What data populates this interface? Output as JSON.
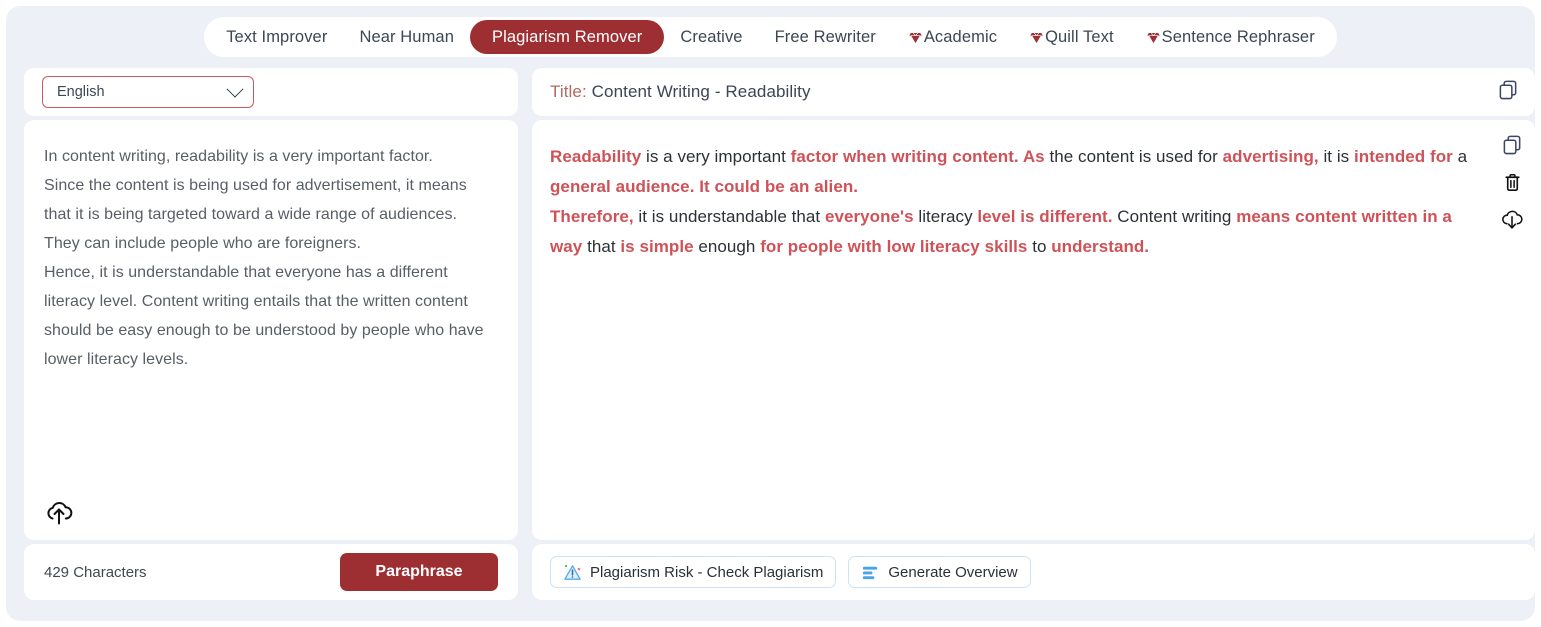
{
  "tabs": [
    {
      "label": "Text Improver",
      "active": false,
      "gem": false
    },
    {
      "label": "Near Human",
      "active": false,
      "gem": false
    },
    {
      "label": "Plagiarism Remover",
      "active": true,
      "gem": false
    },
    {
      "label": "Creative",
      "active": false,
      "gem": false
    },
    {
      "label": "Free Rewriter",
      "active": false,
      "gem": false
    },
    {
      "label": "Academic",
      "active": false,
      "gem": true
    },
    {
      "label": "Quill Text",
      "active": false,
      "gem": true
    },
    {
      "label": "Sentence Rephraser",
      "active": false,
      "gem": true
    }
  ],
  "left_panel": {
    "language_selected": "English",
    "language_icon": "chevron-down-icon",
    "input_text": "In content writing, readability is a very important factor.\nSince the content is being used for advertisement, it means that it is being targeted toward a wide range of audiences.\nThey can include people who are foreigners.\nHence, it is understandable that everyone has a different literacy level. Content writing entails that the written content should be easy enough to be understood by people who have lower literacy levels.",
    "upload_icon": "upload-cloud-icon",
    "character_count": "429 Characters",
    "paraphrase_label": "Paraphrase"
  },
  "right_panel": {
    "title_label": "Title:",
    "title_value": "Content Writing - Readability",
    "header_copy_icon": "copy-icon",
    "side_icons": [
      "copy-icon",
      "trash-icon",
      "download-cloud-icon"
    ],
    "output_segments": [
      {
        "text": "Readability",
        "highlight": true
      },
      {
        "text": " is a very important ",
        "highlight": false
      },
      {
        "text": "factor when writing content. As",
        "highlight": true
      },
      {
        "text": " the content is used for ",
        "highlight": false
      },
      {
        "text": "advertising,",
        "highlight": true
      },
      {
        "text": " it is ",
        "highlight": false
      },
      {
        "text": "intended for",
        "highlight": true
      },
      {
        "text": " a ",
        "highlight": false
      },
      {
        "text": "general audience. It could be an alien.",
        "highlight": true
      },
      {
        "text": "\n",
        "highlight": false
      },
      {
        "text": "Therefore,",
        "highlight": true
      },
      {
        "text": " it is understandable that ",
        "highlight": false
      },
      {
        "text": "everyone's",
        "highlight": true
      },
      {
        "text": " literacy ",
        "highlight": false
      },
      {
        "text": "level is different.",
        "highlight": true
      },
      {
        "text": " Content writing ",
        "highlight": false
      },
      {
        "text": "means content written in a way",
        "highlight": true
      },
      {
        "text": " that ",
        "highlight": false
      },
      {
        "text": "is simple",
        "highlight": true
      },
      {
        "text": " enough ",
        "highlight": false
      },
      {
        "text": "for people with low literacy skills",
        "highlight": true
      },
      {
        "text": " to ",
        "highlight": false
      },
      {
        "text": "understand.",
        "highlight": true
      }
    ],
    "plagiarism_button": "Plagiarism Risk - Check Plagiarism",
    "plagiarism_icon": "warning-triangle-icon",
    "overview_button": "Generate Overview",
    "overview_icon": "bar-list-icon"
  },
  "colors": {
    "accent_red": "#9d2f32",
    "highlight_red": "#cf5258",
    "select_border": "#c95b5f",
    "page_bg": "#edf1f7",
    "pill_border": "#cfe2f3",
    "button_blue": "#4aa3e8"
  }
}
